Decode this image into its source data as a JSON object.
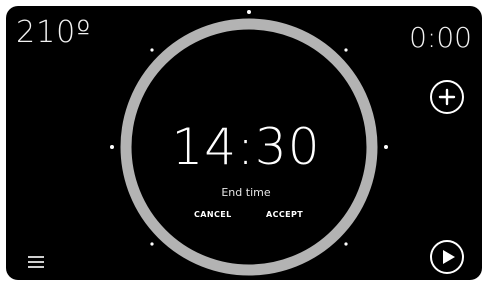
{
  "status": {
    "temperature": "210º",
    "timer": "0:00"
  },
  "dial": {
    "time": "14:30",
    "label": "End time",
    "cancel_label": "CANCEL",
    "accept_label": "ACCEPT"
  },
  "icons": {
    "add": "plus-icon",
    "play": "play-icon",
    "menu": "menu-icon"
  },
  "colors": {
    "background": "#000000",
    "ring": "#b3b3b3",
    "text": "#ffffff"
  }
}
